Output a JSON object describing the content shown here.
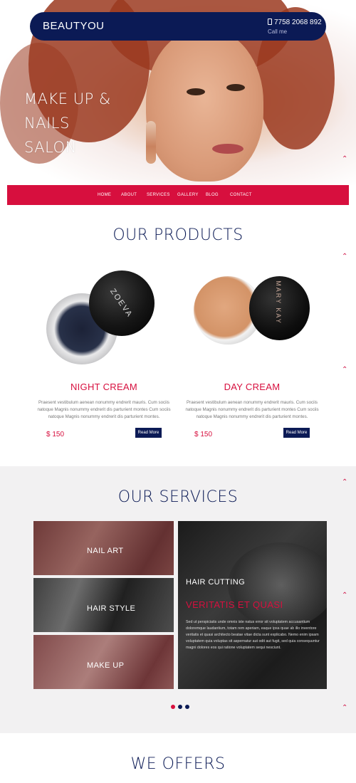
{
  "header": {
    "logo": "BEAUTYOU",
    "phone": "7758 2068 892",
    "call_label": "Call me"
  },
  "hero": {
    "title_line1": "MAKE UP & NAILS",
    "title_line2": "SALON"
  },
  "nav": {
    "items": [
      "HOME",
      "ABOUT",
      "SERVICES",
      "GALLERY",
      "BLOG",
      "CONTACT"
    ]
  },
  "products": {
    "title": "OUR PRODUCTS",
    "items": [
      {
        "name": "NIGHT CREAM",
        "description": "Praesent vestibulum aenean nonummy endrerit mauris. Cum sociis natoque Magnis nonummy endrerit dis parturient montes Cum sociis natoque Magnis nonummy endrerit dis parturient montes.",
        "price": "$ 150",
        "button": "Read More",
        "jar_brand": "ZOEVA"
      },
      {
        "name": "DAY CREAM",
        "description": "Praesent vestibulum aenean nonummy endrerit mauris. Cum sociis natoque Magnis nonummy endrerit dis parturient montes Cum sociis natoque Magnis nonummy endrerit dis parturient montes.",
        "price": "$ 150",
        "button": "Read More",
        "jar_brand": "MARY KAY"
      }
    ]
  },
  "services": {
    "title": "OUR SERVICES",
    "tiles": [
      "NAIL ART",
      "HAIR STYLE",
      "MAKE UP"
    ],
    "feature": {
      "heading": "HAIR CUTTING",
      "subheading": "VERITATIS ET QUASI",
      "text": "Sed ut perspiciatis unde omnis iste natus error sit voluptatem accusantium doloremque laudantium, totam rem aperiam, eaque ipsa quae ab illo inventore veritatis et quasi architecto beatae vitae dicta sunt explicabo. Nemo enim ipsam voluptatem quia voluptas sit aspernatur aut odit aut fugit, sed quia consequuntur magni dolores eos qui ratione voluptatem sequi nesciunt."
    }
  },
  "offers": {
    "title": "WE OFFERS"
  },
  "colors": {
    "navy": "#0b1a55",
    "accent": "#d70f3e",
    "services_bg": "#f2f1f2"
  },
  "icons": [
    "phone-icon",
    "scroll-up-chevron-icon"
  ]
}
